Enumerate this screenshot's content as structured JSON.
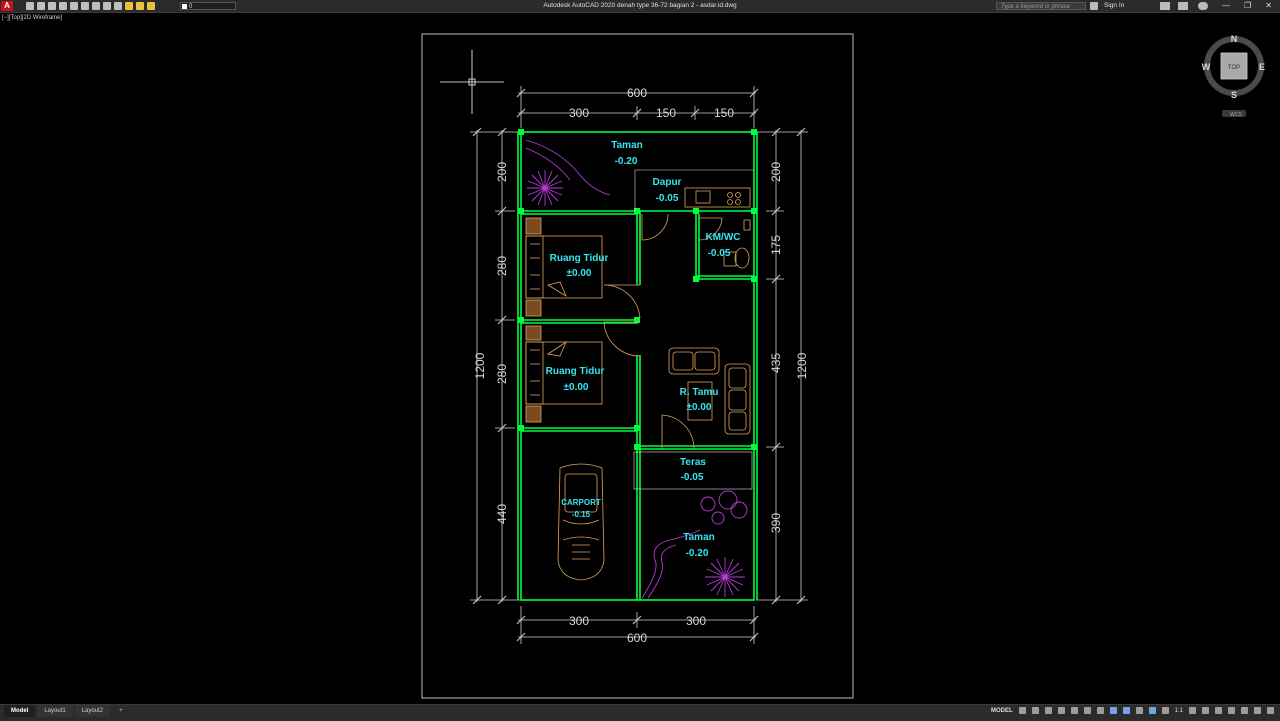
{
  "app": {
    "logo_letter": "A",
    "title": "Autodesk AutoCAD 2020     denah type 36-72 bagian 2 - asdar.id.dwg",
    "layer_value": "0",
    "search_placeholder": "Type a keyword or phrase",
    "sign_in": "Sign In",
    "window_buttons": [
      "—",
      "❐",
      "✕"
    ]
  },
  "viewport_label": "[−][Top][2D Wireframe]",
  "viewcube": {
    "n": "N",
    "s": "S",
    "e": "E",
    "w": "W",
    "face": "TOP",
    "wcs": "WCS"
  },
  "dimensions": {
    "top_total": "600",
    "top_left": "300",
    "top_mid": "150",
    "top_right": "150",
    "bottom_left": "300",
    "bottom_right": "300",
    "bottom_total": "600",
    "left_200": "200",
    "left_280a": "280",
    "left_280b": "280",
    "left_total": "1200",
    "left_440": "440",
    "right_200": "200",
    "right_175": "175",
    "right_435": "435",
    "right_total": "1200",
    "right_390": "390"
  },
  "rooms": {
    "taman_top": {
      "name": "Taman",
      "elev": "-0.20"
    },
    "dapur": {
      "name": "Dapur",
      "elev": "-0.05"
    },
    "kmwc": {
      "name": "KM/WC",
      "elev": "-0.05"
    },
    "tidur1": {
      "name": "Ruang Tidur",
      "elev": "±0.00"
    },
    "tidur2": {
      "name": "Ruang Tidur",
      "elev": "±0.00"
    },
    "tamu": {
      "name": "R. Tamu",
      "elev": "±0.00"
    },
    "teras": {
      "name": "Teras",
      "elev": "-0.05"
    },
    "carport": {
      "name": "CARPORT",
      "elev": "-0.15"
    },
    "taman_bottom": {
      "name": "Taman",
      "elev": "-0.20"
    }
  },
  "tabs": [
    "Model",
    "Layout1",
    "Layout2",
    "+"
  ],
  "status": {
    "mode": "MODEL",
    "scale": "1:1"
  },
  "colors": {
    "wall": "#00ff3c",
    "dim": "#d0d0d0",
    "label": "#35e6f0",
    "furniture": "#e0a35a",
    "plant": "#b83bd6"
  }
}
